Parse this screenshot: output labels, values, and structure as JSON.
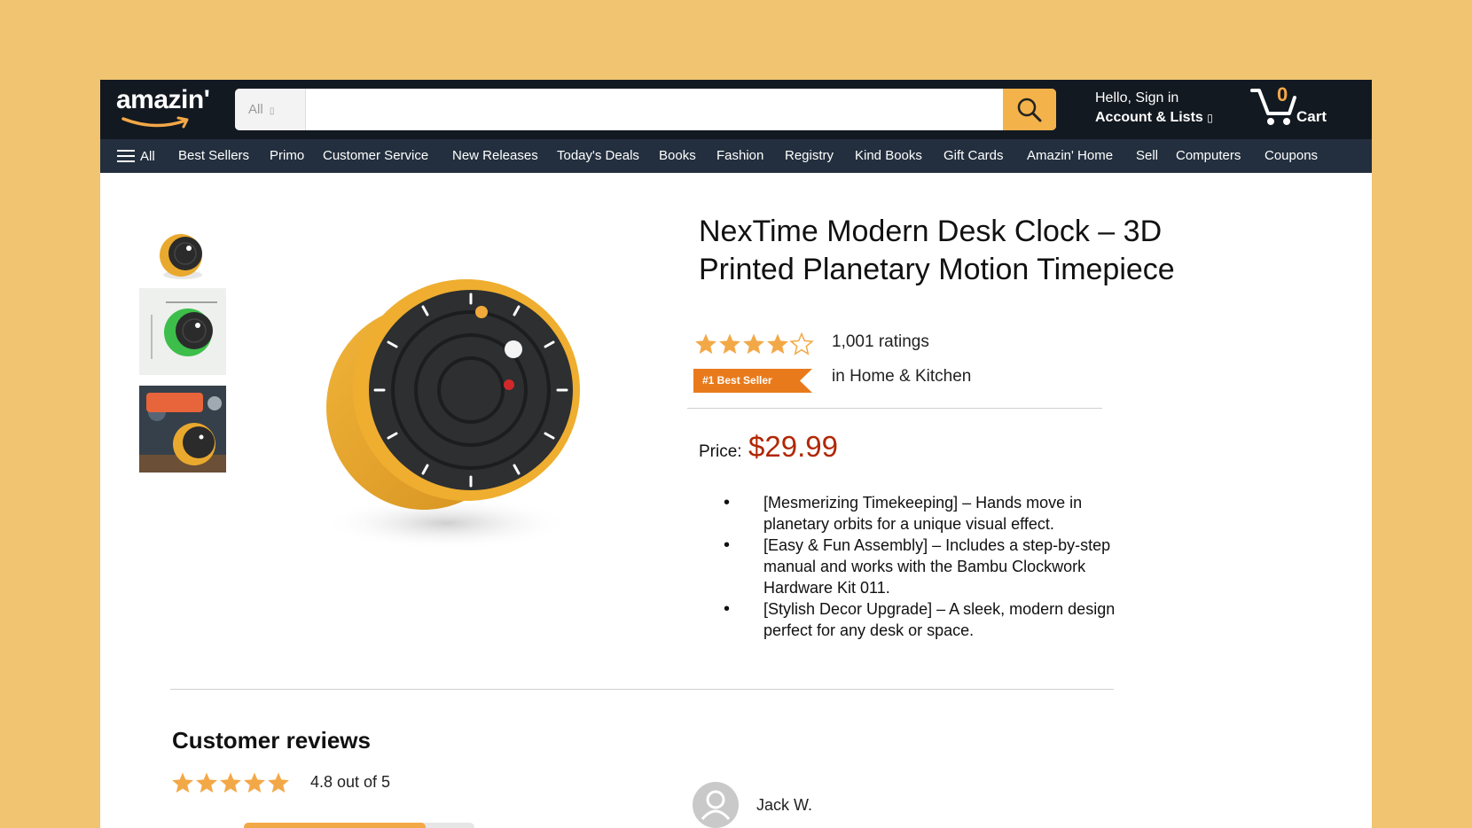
{
  "colors": {
    "background": "#F0C470",
    "header": "#131921",
    "nav": "#232F3E",
    "accent": "#F3A847",
    "price": "#B12704",
    "star": "#F3A847"
  },
  "header": {
    "logo": "amazin'",
    "search": {
      "category": "All",
      "placeholder": ""
    },
    "account": {
      "greeting": "Hello, Sign in",
      "label": "Account & Lists"
    },
    "cart": {
      "count": "0",
      "label": "Cart"
    }
  },
  "nav": {
    "all_label": "All",
    "items": [
      "Best Sellers",
      "Primo",
      "Customer Service",
      "New Releases",
      "Today's Deals",
      "Books",
      "Fashion",
      "Registry",
      "Kind Books",
      "Gift Cards",
      "Amazin' Home",
      "Sell",
      "Computers",
      "Coupons"
    ]
  },
  "product": {
    "title": "NexTime Modern Desk Clock – 3D Printed Planetary Motion Timepiece",
    "rating": 4,
    "rating_max": 5,
    "ratings_count": "1,001  ratings",
    "badge": "#1 Best Seller",
    "badge_category": "in Home & Kitchen",
    "price_label": "Price:",
    "price": "$29.99",
    "bullets": [
      "[Mesmerizing Timekeeping] – Hands move in planetary orbits for a unique visual effect.",
      "[Easy & Fun Assembly] – Includes a step-by-step manual and works with the Bambu Clockwork Hardware Kit 011.",
      "[Stylish Decor Upgrade] – A sleek, modern design perfect for any desk or space."
    ],
    "thumbnails": [
      "clock-front",
      "clock-green-dimensions",
      "clock-lifestyle"
    ]
  },
  "reviews": {
    "heading": "Customer reviews",
    "stars": 5,
    "average": "4.8 out of 5",
    "histogram_fill": 0.79,
    "reviewer": "Jack W."
  }
}
